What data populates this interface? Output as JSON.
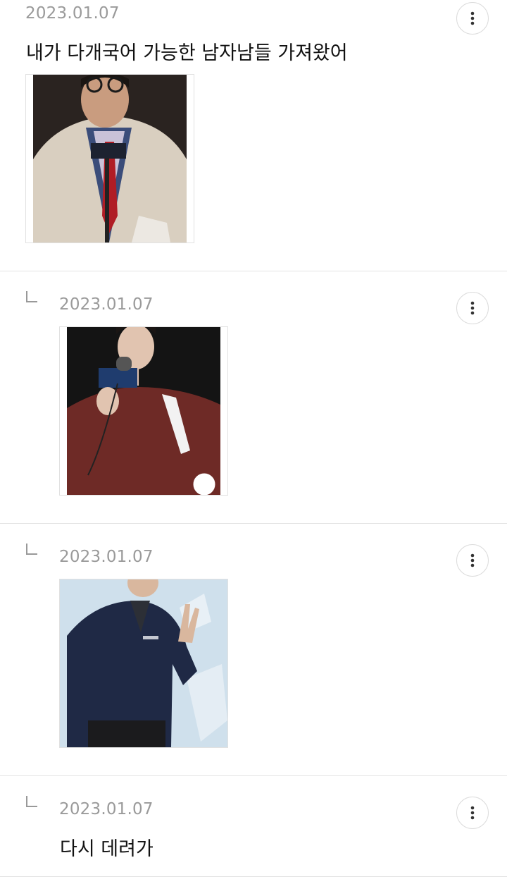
{
  "comments": [
    {
      "date": "2023.01.07",
      "text": "내가 다개국어 가능한 남자남들 가져왔어",
      "image_icon": "photo-man-glasses-trenchcoat-microphone",
      "is_reply": false
    },
    {
      "date": "2023.01.07",
      "text": "",
      "image_icon": "photo-man-red-sweater-microphone",
      "is_reply": true
    },
    {
      "date": "2023.01.07",
      "text": "",
      "image_icon": "photo-man-navy-jacket-peace-sign",
      "is_reply": true
    },
    {
      "date": "2023.01.07",
      "text": "다시 데려가",
      "image_icon": "",
      "is_reply": true
    }
  ],
  "icons": {
    "more": "more-vertical-icon",
    "reply": "reply-arrow-icon"
  },
  "colors": {
    "date": "#9a9a9a",
    "divider": "#e3e3e3",
    "text": "#111111"
  }
}
